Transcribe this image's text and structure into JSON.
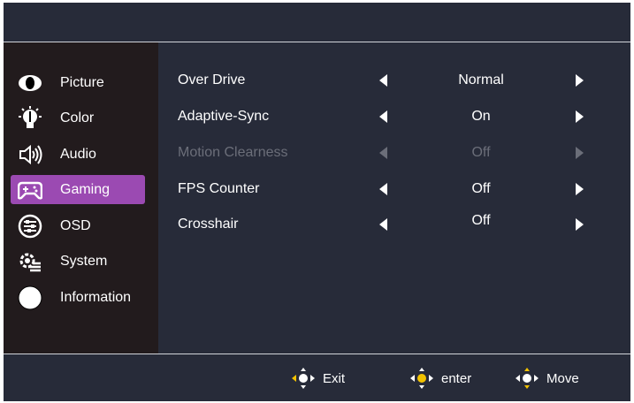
{
  "sidebar": {
    "items": [
      {
        "label": "Picture",
        "icon": "eye-icon"
      },
      {
        "label": "Color",
        "icon": "color-bulb-icon"
      },
      {
        "label": "Audio",
        "icon": "speaker-icon"
      },
      {
        "label": "Gaming",
        "icon": "gamepad-icon",
        "active": true
      },
      {
        "label": "OSD",
        "icon": "osd-sliders-icon"
      },
      {
        "label": "System",
        "icon": "system-settings-icon"
      },
      {
        "label": "Information",
        "icon": "info-circle-icon"
      }
    ],
    "active_color": "#9b4ab2"
  },
  "settings": [
    {
      "label": "Over Drive",
      "value": "Normal",
      "enabled": true
    },
    {
      "label": "Adaptive-Sync",
      "value": "On",
      "enabled": true
    },
    {
      "label": "Motion Clearness",
      "value": "Off",
      "enabled": false
    },
    {
      "label": "FPS Counter",
      "value": "Off",
      "enabled": true
    },
    {
      "label": "Crosshair",
      "value": "Off",
      "enabled": true
    }
  ],
  "footer": {
    "exit_label": "Exit",
    "enter_label": "enter",
    "move_label": "Move",
    "accent_color": "#f2c200"
  }
}
